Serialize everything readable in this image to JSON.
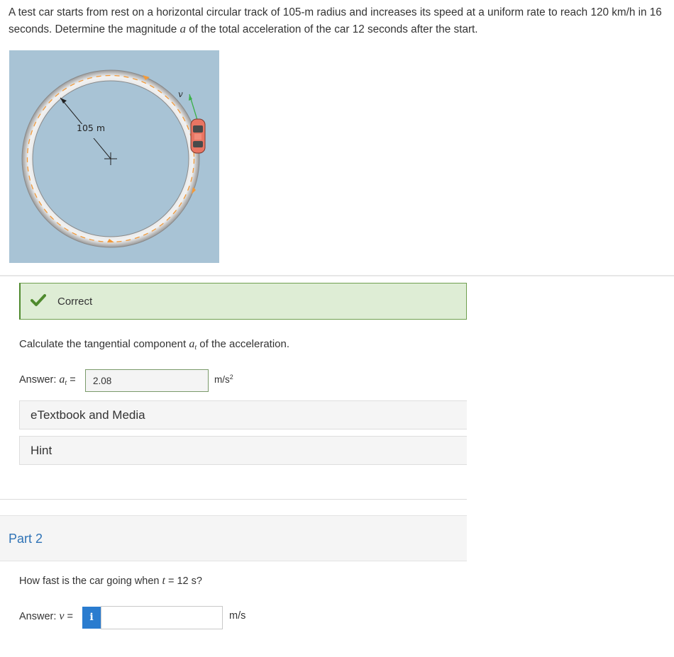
{
  "problem": {
    "text_part1": "A test car starts from rest on a horizontal circular track of 105-m radius and increases its speed at a uniform rate to reach 120 km/h in 16 seconds. Determine the magnitude ",
    "var_a": "a",
    "text_part2": " of the total acceleration of the car 12 seconds after the start."
  },
  "figure": {
    "radius_label": "105 m",
    "velocity_label": "v"
  },
  "part1": {
    "status": "Correct",
    "question_prefix": "Calculate the tangential component ",
    "question_var": "a",
    "question_sub": "t",
    "question_suffix": " of the acceleration.",
    "answer_prefix": "Answer: ",
    "answer_var": "a",
    "answer_sub": "t",
    "answer_eq": " =",
    "answer_value": "2.08",
    "unit_base": "m/s",
    "unit_exp": "2",
    "etextbook_label": "eTextbook and Media",
    "hint_label": "Hint"
  },
  "part2": {
    "title": "Part 2",
    "question_prefix": "How fast is the car going when ",
    "question_var": "t",
    "question_suffix": " = 12 s?",
    "answer_prefix": "Answer: ",
    "answer_var": "v",
    "answer_eq": " =",
    "info_icon": "i",
    "answer_value": "",
    "unit": "m/s"
  },
  "colors": {
    "correct_bg": "#deedd5",
    "check_green": "#4f8a2e",
    "part_title_blue": "#2f73b6",
    "info_blue": "#2a7ccf",
    "figure_bg": "#a8c3d5"
  }
}
